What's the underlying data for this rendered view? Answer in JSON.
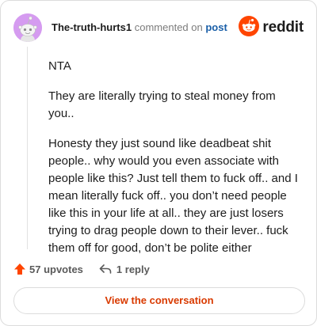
{
  "comment": {
    "author": "The-truth-hurts1",
    "action_text": "commented on",
    "post_link": "post",
    "paragraphs": [
      "NTA",
      "They are literally trying to steal money from you..",
      "Honesty they just sound like deadbeat shit people.. why would you even associate with people like this? Just tell them to fuck off.. and I mean literally fuck off.. you don’t need people like this in your life at all.. they are just losers trying to drag people down to their lever.. fuck them off for good, don’t be polite either"
    ]
  },
  "brand": {
    "name": "reddit",
    "color": "#ff4500"
  },
  "actions": {
    "upvotes": "57 upvotes",
    "replies": "1 reply"
  },
  "footer": {
    "button_label": "View the conversation"
  },
  "colors": {
    "accent": "#d93a00",
    "link": "#1a5fa8",
    "upvote": "#ff4500",
    "avatar_bg": "#d59bf0"
  },
  "icons": [
    "snoo-avatar-icon",
    "reddit-logo-icon",
    "upvote-arrow-icon",
    "reply-arrow-icon"
  ]
}
